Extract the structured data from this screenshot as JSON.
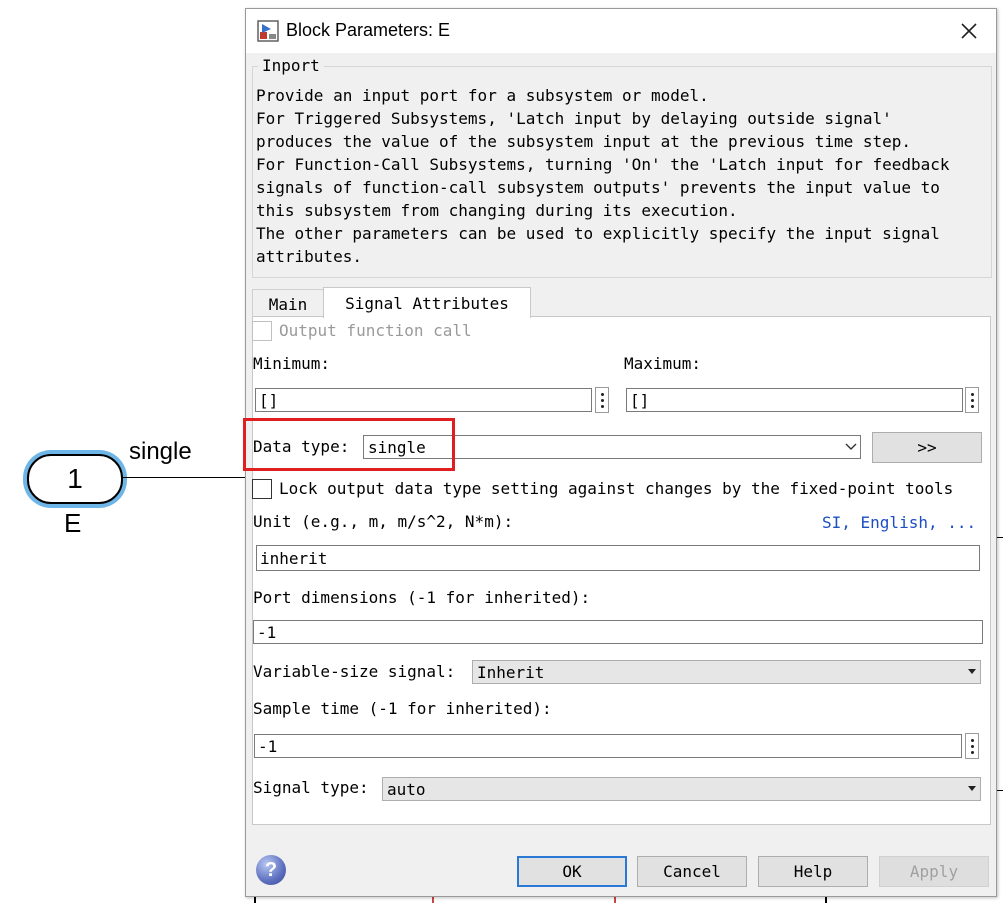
{
  "canvas": {
    "inport_number": "1",
    "signal_label": "single",
    "block_name": "E"
  },
  "dialog": {
    "title": "Block Parameters: E",
    "group_title": "Inport",
    "description": [
      "Provide an input port for a subsystem or model.",
      "For Triggered Subsystems, 'Latch input by delaying outside signal'",
      "produces the value of the subsystem input at the previous time step.",
      "For Function-Call Subsystems, turning 'On' the 'Latch input for feedback",
      "signals of function-call subsystem outputs' prevents the input value to",
      "this subsystem from changing during its execution.",
      "The other parameters can be used to explicitly specify the input signal",
      "attributes."
    ],
    "tabs": {
      "main": "Main",
      "signal_attributes": "Signal Attributes",
      "active": "Signal Attributes"
    },
    "fields": {
      "output_function_call": {
        "label": "Output function call",
        "checked": false,
        "enabled": false
      },
      "minimum": {
        "label": "Minimum:",
        "value": "[]"
      },
      "maximum": {
        "label": "Maximum:",
        "value": "[]"
      },
      "data_type": {
        "label": "Data type:",
        "value": "single",
        "assistant_button": ">>"
      },
      "lock_output": {
        "label": "Lock output data type setting against changes by the fixed-point tools",
        "checked": false
      },
      "unit": {
        "label": "Unit (e.g., m, m/s^2, N*m):",
        "link": "SI, English, ...",
        "value": "inherit"
      },
      "port_dimensions": {
        "label": "Port dimensions (-1 for inherited):",
        "value": "-1"
      },
      "variable_size": {
        "label": "Variable-size signal:",
        "value": "Inherit"
      },
      "sample_time": {
        "label": "Sample time (-1 for inherited):",
        "value": "-1"
      },
      "signal_type": {
        "label": "Signal type:",
        "value": "auto"
      }
    },
    "buttons": {
      "ok": "OK",
      "cancel": "Cancel",
      "help": "Help",
      "apply": "Apply"
    }
  },
  "colors": {
    "highlight": "#e02020",
    "link": "#1b4fc3",
    "block_selection": "#6fb6e8",
    "default_button_border": "#2b79d6"
  },
  "icons": {
    "title": "simulink-block-icon",
    "close": "close-icon",
    "help": "help-icon",
    "dropdown": "chevron-down-icon",
    "more_options": "vertical-dots-icon"
  }
}
